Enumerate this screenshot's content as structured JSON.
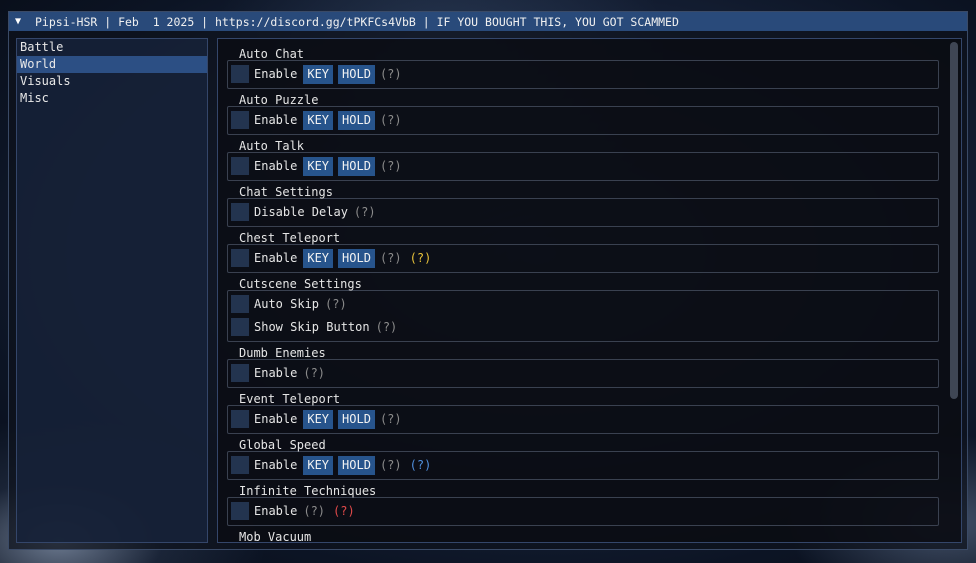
{
  "window": {
    "collapse_glyph": "▼",
    "title": "Pipsi-HSR | Feb  1 2025 | https://discord.gg/tPKFCs4VbB | IF YOU BOUGHT THIS, YOU GOT SCAMMED"
  },
  "sidebar": {
    "items": [
      {
        "label": "Battle",
        "active": false
      },
      {
        "label": "World",
        "active": true
      },
      {
        "label": "Visuals",
        "active": false
      },
      {
        "label": "Misc",
        "active": false
      }
    ]
  },
  "labels": {
    "enable": "Enable",
    "key": "KEY",
    "hold": "HOLD",
    "help": "(?)",
    "disable_delay": "Disable Delay",
    "auto_skip": "Auto Skip",
    "show_skip_button": "Show Skip Button"
  },
  "sections": {
    "auto_chat": "Auto Chat",
    "auto_puzzle": "Auto Puzzle",
    "auto_talk": "Auto Talk",
    "chat_settings": "Chat Settings",
    "chest_teleport": "Chest Teleport",
    "cutscene_settings": "Cutscene Settings",
    "dumb_enemies": "Dumb Enemies",
    "event_teleport": "Event Teleport",
    "global_speed": "Global Speed",
    "infinite_techniques": "Infinite Techniques",
    "mob_vacuum": "Mob Vacuum"
  },
  "colors": {
    "titlebar": "#294a7a",
    "selected_item": "#2c4f84",
    "button": "#27548c",
    "help_yellow": "#e8c23a",
    "help_blue": "#4f8fdc",
    "help_red": "#e04a4a"
  }
}
